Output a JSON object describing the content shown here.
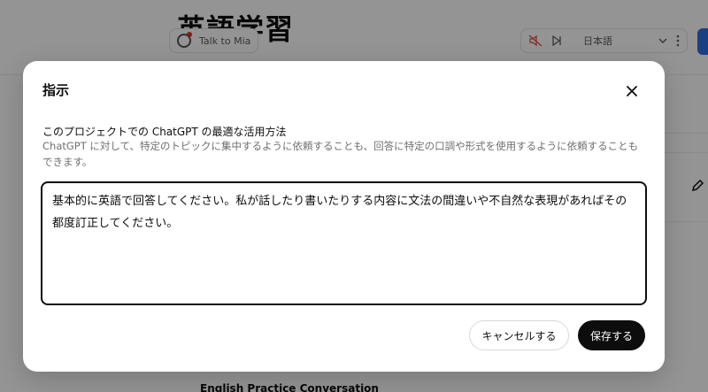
{
  "background": {
    "project_title": "英語学習",
    "talk_button_label": "Talk to Mia",
    "language": "日本語",
    "conversation_title": "English Practice Conversation"
  },
  "dialog": {
    "title": "指示",
    "heading": "このプロジェクトでの ChatGPT の最適な活用方法",
    "description": "ChatGPT に対して、特定のトピックに集中するように依頼することも、回答に特定の口調や形式を使用するように依頼することもできます。",
    "instructions_value": "基本的に英語で回答してください。私が話したり書いたりする内容に文法の間違いや不自然な表現があればその都度訂正してください。",
    "cancel_label": "キャンセルする",
    "save_label": "保存する"
  }
}
